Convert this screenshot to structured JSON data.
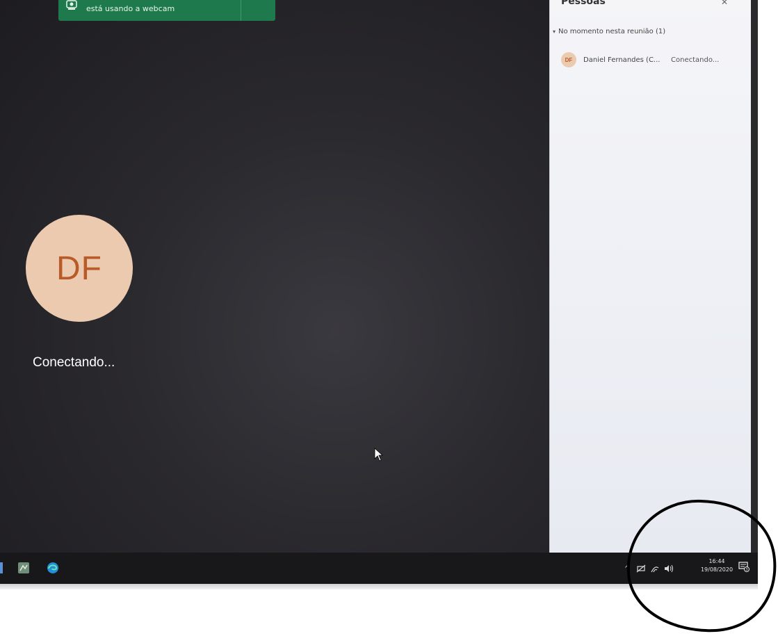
{
  "webcam_toast": {
    "text": "está usando a webcam",
    "icon": "webcam-icon"
  },
  "participant": {
    "initials": "DF",
    "status": "Conectando..."
  },
  "people_panel": {
    "title": "Pessoas",
    "section_label": "No momento nesta reunião (1)",
    "members": [
      {
        "initials": "DF",
        "name": "Daniel Fernandes (C...",
        "status": "Conectando..."
      }
    ]
  },
  "taskbar": {
    "pinned_icons": [
      "teams-app-icon",
      "edge-icon"
    ],
    "tray_icons": [
      "chevron-up-icon",
      "network-icon",
      "wifi-icon",
      "volume-icon"
    ],
    "time": "16:44",
    "date": "19/08/2020"
  },
  "colors": {
    "toast_green": "#1e7a4c",
    "avatar_bg": "#eccab0",
    "avatar_text": "#b85b26",
    "annotation_stroke": "#000000"
  }
}
